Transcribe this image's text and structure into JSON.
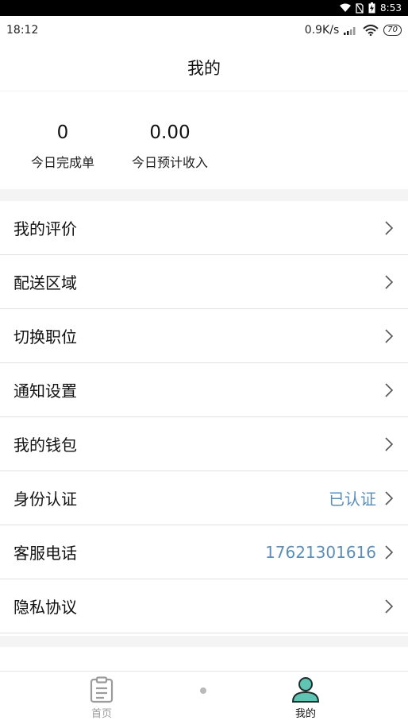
{
  "system_bar": {
    "time": "8:53"
  },
  "status_bar": {
    "time": "18:12",
    "net_speed": "0.9K/s",
    "battery": "70"
  },
  "header": {
    "title": "我的"
  },
  "stats": [
    {
      "value": "0",
      "label": "今日完成单"
    },
    {
      "value": "0.00",
      "label": "今日预计收入"
    }
  ],
  "menu": [
    {
      "label": "我的评价",
      "value": ""
    },
    {
      "label": "配送区域",
      "value": ""
    },
    {
      "label": "切换职位",
      "value": ""
    },
    {
      "label": "通知设置",
      "value": ""
    },
    {
      "label": "我的钱包",
      "value": ""
    },
    {
      "label": "身份认证",
      "value": "已认证"
    },
    {
      "label": "客服电话",
      "value": "17621301616"
    },
    {
      "label": "隐私协议",
      "value": ""
    }
  ],
  "tabbar": {
    "home_label": "首页",
    "mine_label": "我的"
  },
  "colors": {
    "accent_value": "#5b8db7",
    "tab_active_icon": "#5fc4b4",
    "tab_inactive": "#9b9b9b"
  },
  "icons": {
    "home_tab": "clipboard-icon",
    "mine_tab": "person-icon"
  }
}
